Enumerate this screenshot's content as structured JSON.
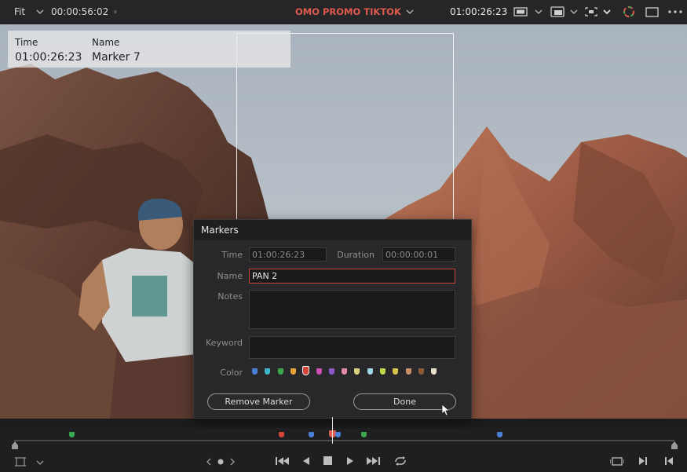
{
  "topbar": {
    "zoom_label": "Fit",
    "source_timecode": "00:00:56:02",
    "project_title": "OMO PROMO TIKTOK",
    "record_timecode": "01:00:26:23"
  },
  "overlay": {
    "time_label": "Time",
    "time_value": "01:00:26:23",
    "name_label": "Name",
    "name_value": "Marker 7"
  },
  "dialog": {
    "title": "Markers",
    "time_label": "Time",
    "time_value": "01:00:26:23",
    "duration_label": "Duration",
    "duration_value": "00:00:00:01",
    "name_label": "Name",
    "name_value": "PAN 2",
    "notes_label": "Notes",
    "keyword_label": "Keyword",
    "color_label": "Color",
    "remove_label": "Remove Marker",
    "done_label": "Done"
  },
  "colors": {
    "swatches": [
      "#4a7fd6",
      "#3fb5c9",
      "#3aa84e",
      "#e8a53b",
      "#d84538",
      "#cc4fb5",
      "#8a57c9",
      "#e08aa8",
      "#d8d080",
      "#9fd6e8",
      "#b8d84a",
      "#d8c24a",
      "#c8906a",
      "#8a5a3a",
      "#e8e0c8"
    ],
    "accent_red": "#e05a4e"
  }
}
